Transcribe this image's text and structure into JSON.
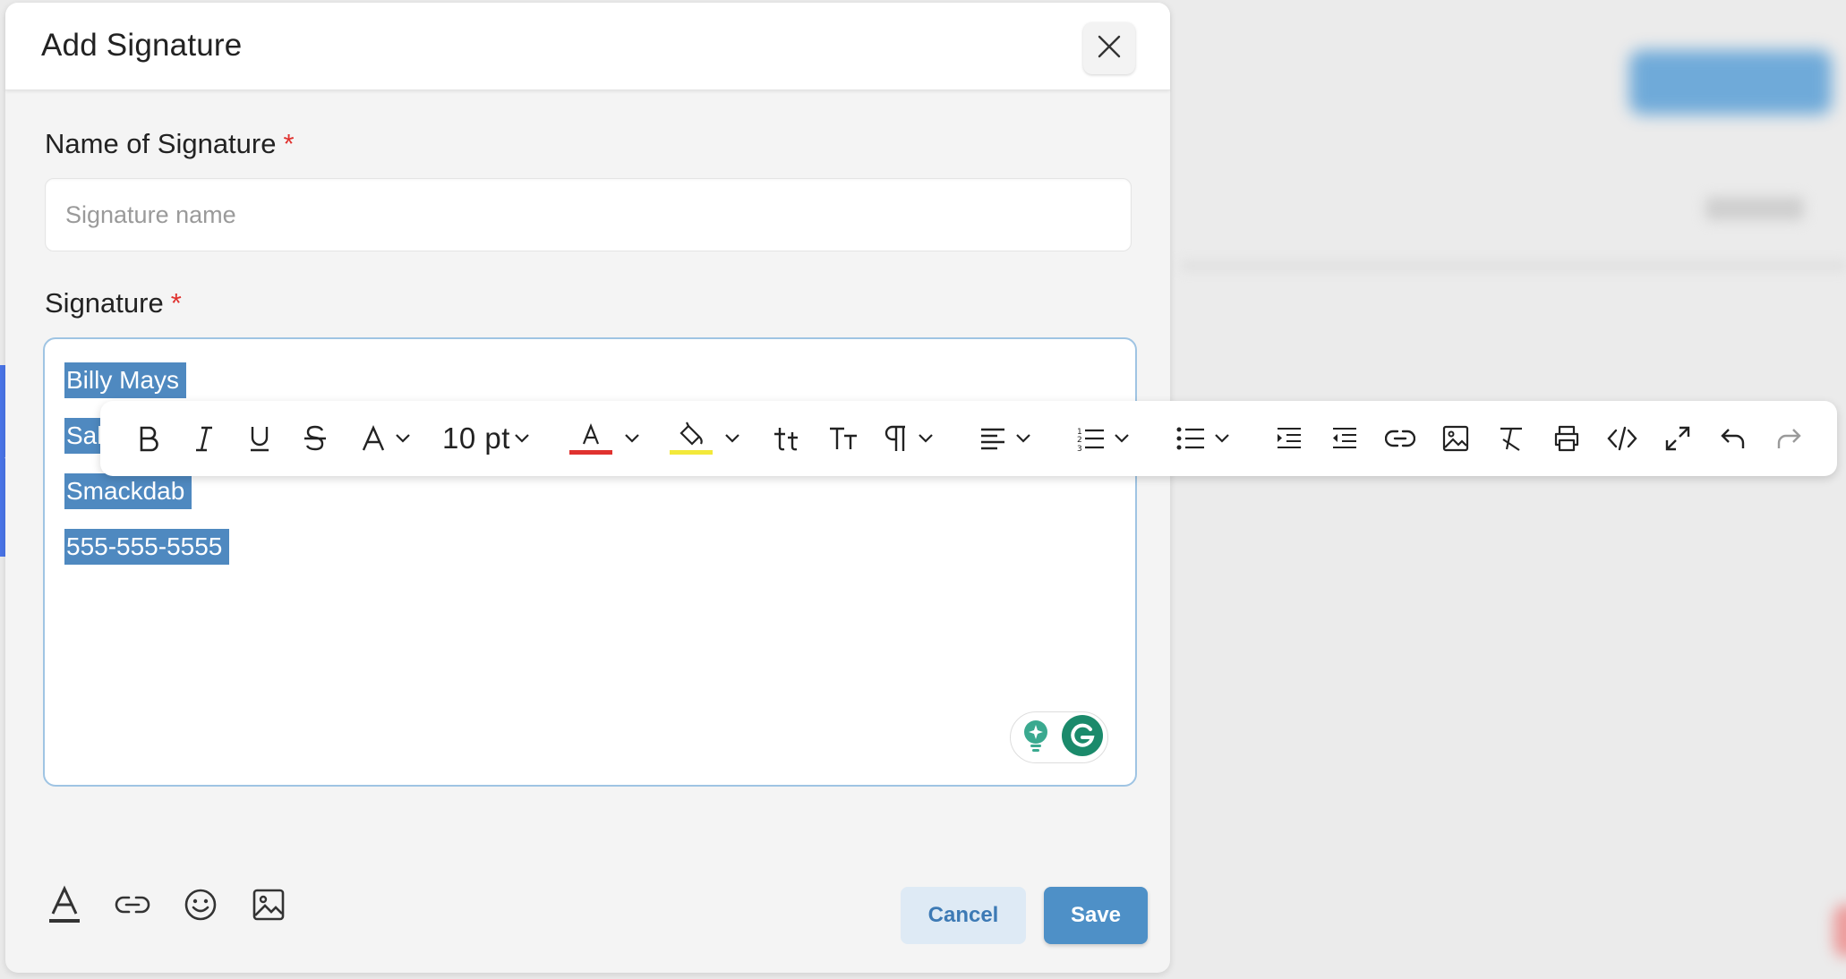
{
  "modal": {
    "title": "Add Signature",
    "close_icon": "close-icon"
  },
  "name_field": {
    "label": "Name of Signature",
    "required_mark": "*",
    "value": "",
    "placeholder": "Signature name"
  },
  "signature_field": {
    "label": "Signature",
    "required_mark": "*",
    "lines": [
      "Billy Mays",
      "Sal",
      "Smackdab",
      "555-555-5555"
    ]
  },
  "toolbar": {
    "font_size": "10 pt",
    "text_color": "#e0322f",
    "highlight_color": "#f3e93a",
    "items": [
      "bold-icon",
      "italic-icon",
      "underline-icon",
      "strikethrough-icon",
      "font-family-icon",
      "font-size-select",
      "text-color-icon",
      "highlight-color-icon",
      "lowercase-icon",
      "uppercase-icon",
      "paragraph-icon",
      "align-icon",
      "ordered-list-icon",
      "unordered-list-icon",
      "indent-icon",
      "outdent-icon",
      "link-icon",
      "image-icon",
      "clear-format-icon",
      "print-icon",
      "code-view-icon",
      "fullscreen-icon",
      "undo-icon",
      "redo-icon"
    ]
  },
  "footer": {
    "cancel_label": "Cancel",
    "save_label": "Save",
    "icons": [
      "text-format-icon",
      "link-icon",
      "emoji-icon",
      "image-icon"
    ]
  },
  "colors": {
    "accent": "#4e90c7",
    "selection": "#4f89c0",
    "required": "#e0322f",
    "side_tab": "#4a74e8"
  }
}
